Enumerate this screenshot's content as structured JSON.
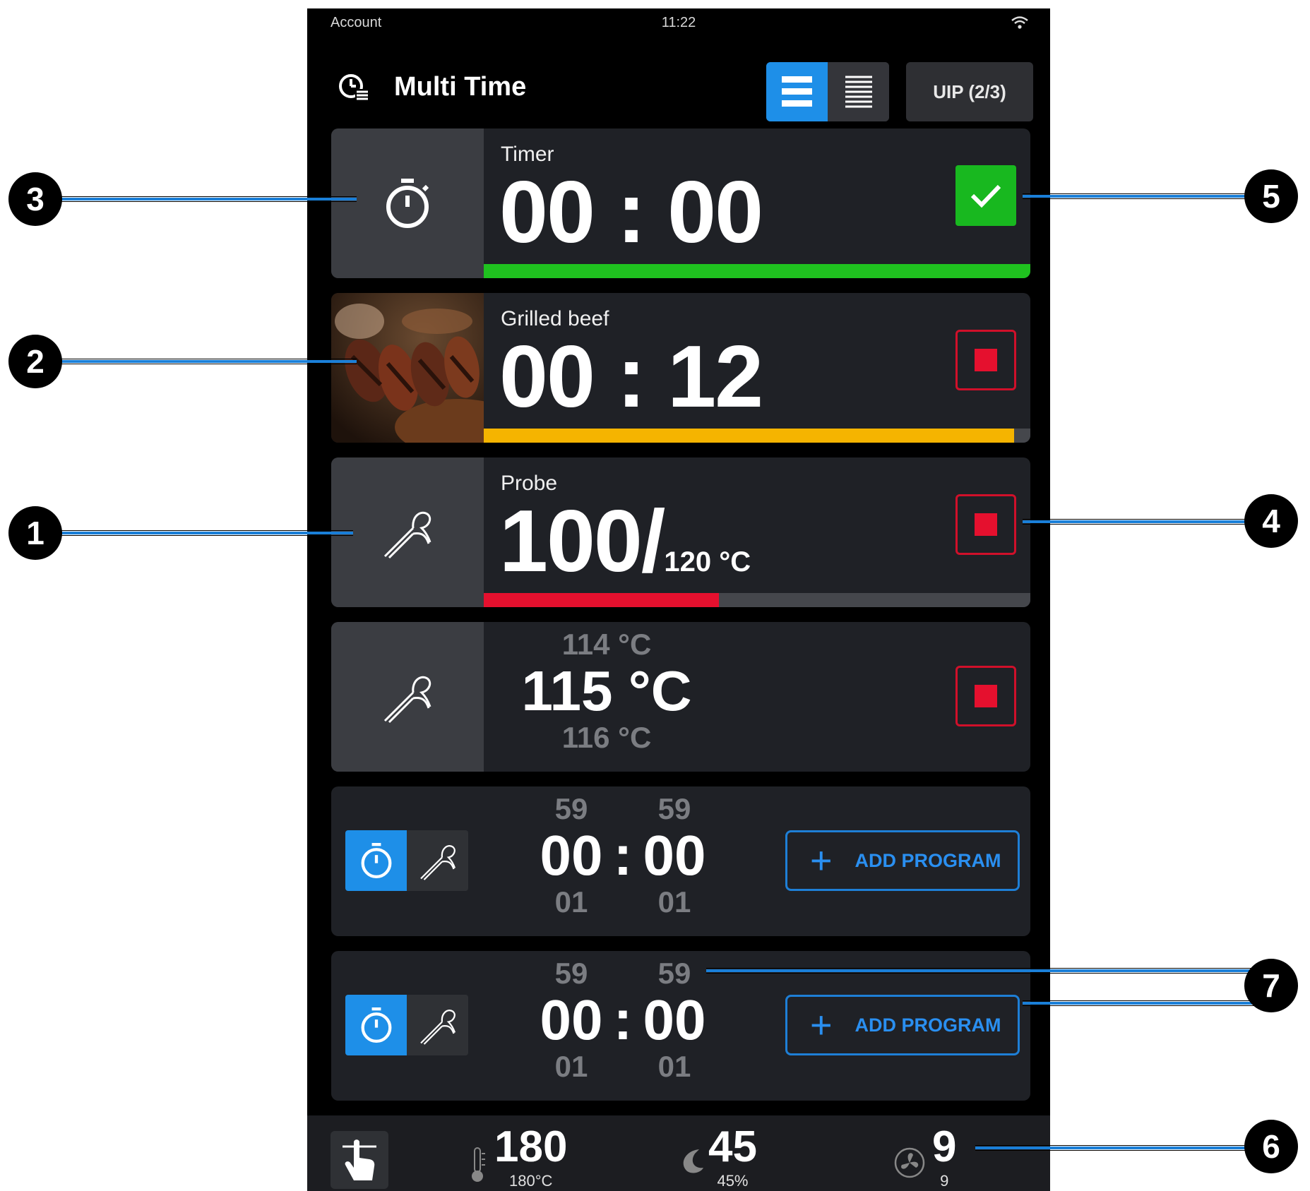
{
  "status_bar": {
    "left": "Account",
    "time": "11:22",
    "wifi_icon": "wifi-icon"
  },
  "header": {
    "title": "Multi Time",
    "title_icon": "multi-time-icon",
    "view_list_icon": "list-view-icon",
    "view_compact_icon": "compact-list-view-icon",
    "uip_label": "UIP (2/3)"
  },
  "cards": {
    "timer": {
      "label": "Timer",
      "time": "00 : 00",
      "progress": 1.0,
      "action_icon": "check-icon",
      "progress_color": "#1fc21f"
    },
    "grilled": {
      "label": "Grilled beef",
      "time": "00 : 12",
      "progress": 0.97,
      "action_icon": "stop-icon",
      "progress_color": "#f5b400"
    },
    "probe": {
      "label": "Probe",
      "value": "100/",
      "target": "120 °C",
      "progress": 0.43,
      "action_icon": "stop-icon",
      "progress_color": "#e5102e"
    },
    "probe_set": {
      "above": "114 °C",
      "value": "115 °C",
      "below": "116 °C",
      "action_icon": "stop-icon"
    },
    "new1": {
      "minutes": {
        "above": "59",
        "value": "00",
        "below": "01"
      },
      "sep": ":",
      "seconds": {
        "above": "59",
        "value": "00",
        "below": "01"
      },
      "add_label": "ADD PROGRAM"
    },
    "new2": {
      "minutes": {
        "above": "59",
        "value": "00",
        "below": "01"
      },
      "sep": ":",
      "seconds": {
        "above": "59",
        "value": "00",
        "below": "01"
      },
      "add_label": "ADD PROGRAM"
    }
  },
  "bottom_bar": {
    "touch_icon": "touch-icon",
    "temperature": {
      "value": "180",
      "sub": "180°C",
      "icon": "thermometer-icon"
    },
    "humidity": {
      "value": "45",
      "sub": "45%",
      "icon": "humidity-icon"
    },
    "fan": {
      "value": "9",
      "sub": "9",
      "icon": "fan-icon"
    }
  },
  "callouts": {
    "c1": "1",
    "c2": "2",
    "c3": "3",
    "c4": "4",
    "c5": "5",
    "c6": "6",
    "c7": "7"
  },
  "colors": {
    "accent": "#1e8fe8",
    "success": "#18b81f",
    "stop": "#e5102e",
    "warning": "#f5b400"
  }
}
